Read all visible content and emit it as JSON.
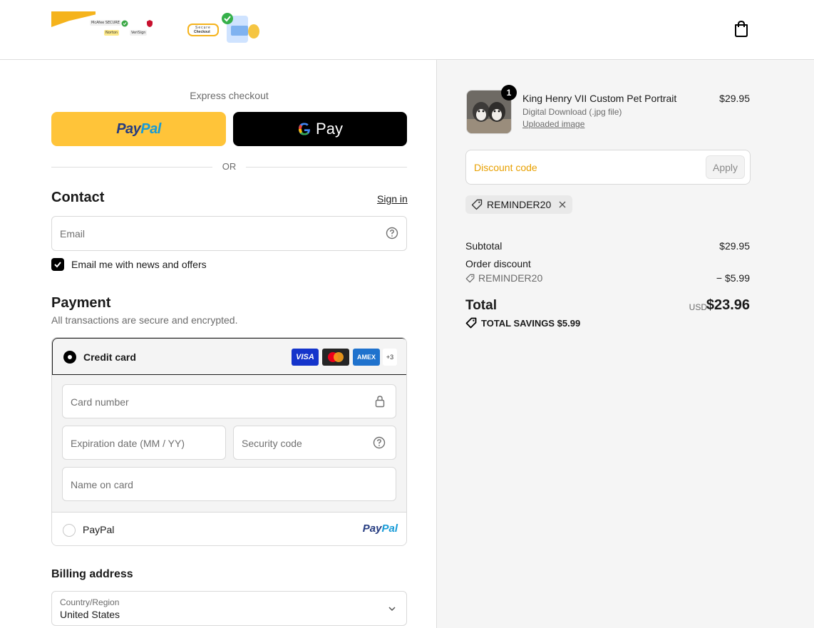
{
  "header": {
    "cart_icon": "shopping-bag-icon",
    "secure_badge_text_1": "Secure",
    "secure_badge_text_2": "Checkout",
    "trust_badges": [
      "McAfee SECURE",
      "Norton",
      "VeriSign"
    ]
  },
  "express": {
    "label": "Express checkout",
    "paypal_label_1": "Pay",
    "paypal_label_2": "Pal",
    "gpay_label": "Pay",
    "or": "OR"
  },
  "contact": {
    "heading": "Contact",
    "signin": "Sign in",
    "email_placeholder": "Email",
    "newsletter_label": "Email me with news and offers"
  },
  "payment": {
    "heading": "Payment",
    "subtitle": "All transactions are secure and encrypted.",
    "credit_card_label": "Credit card",
    "visa": "VISA",
    "amex": "AMEX",
    "more_cards": "+3",
    "card_number_placeholder": "Card number",
    "expiry_placeholder": "Expiration date (MM / YY)",
    "security_placeholder": "Security code",
    "name_placeholder": "Name on card",
    "paypal_label": "PayPal",
    "paypal_logo_1": "Pay",
    "paypal_logo_2": "Pal"
  },
  "billing": {
    "heading": "Billing address",
    "country_label": "Country/Region",
    "country_value": "United States"
  },
  "order": {
    "item_title": "King Henry VII Custom Pet Portrait",
    "item_variant": "Digital Download (.jpg file)",
    "item_link": "Uploaded image",
    "item_price": "$29.95",
    "quantity": "1",
    "discount_placeholder": "Discount code",
    "apply": "Apply",
    "applied_code": "REMINDER20",
    "subtotal_label": "Subtotal",
    "subtotal_value": "$29.95",
    "order_discount_label": "Order discount",
    "discount_code": "REMINDER20",
    "discount_value": "− $5.99",
    "total_label": "Total",
    "currency": "USD",
    "total_value": "$23.96",
    "savings": "TOTAL SAVINGS  $5.99"
  },
  "colors": {
    "paypal_yellow": "#ffc439",
    "accent_orange": "#e8a000",
    "black": "#000000"
  }
}
